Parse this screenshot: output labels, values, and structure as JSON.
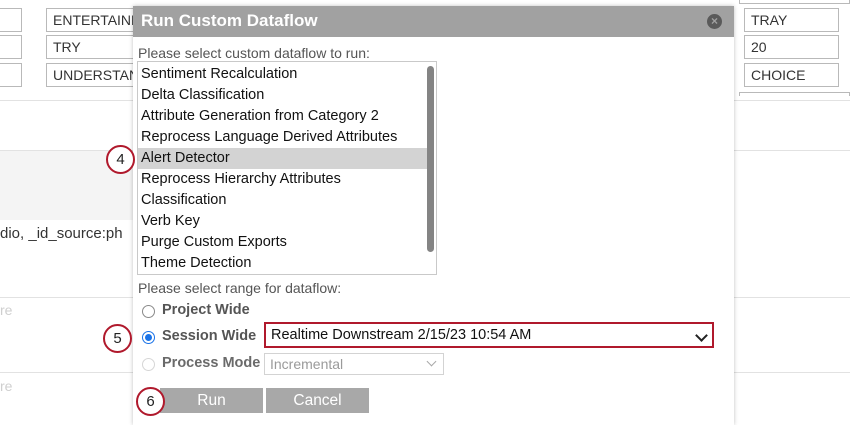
{
  "background": {
    "row1": {
      "col2": "ENTERTAINM",
      "col_right": "TRAY"
    },
    "row2": {
      "col2": "TRY",
      "col_right": "20"
    },
    "row3": {
      "col2": "UNDERSTAN",
      "col_right": "CHOICE"
    },
    "source_text": "dio, _id_source:ph",
    "faint1": "re",
    "faint2": "re"
  },
  "dialog": {
    "title": "Run Custom Dataflow",
    "close_glyph": "×",
    "select_label": "Please select custom dataflow to run:",
    "dataflows": [
      "Sentiment Recalculation",
      "Delta Classification",
      "Attribute Generation from Category 2",
      "Reprocess Language Derived Attributes",
      "Alert Detector",
      "Reprocess Hierarchy Attributes",
      "Classification",
      "Verb Key",
      "Purge Custom Exports",
      "Theme Detection"
    ],
    "selected_dataflow": "Alert Detector",
    "range_label": "Please select range for dataflow:",
    "range_options": {
      "project_wide": "Project Wide",
      "session_wide": "Session Wide",
      "process_mode": "Process Mode"
    },
    "selected_range": "Session Wide",
    "session_value": "Realtime Downstream 2/15/23 10:54 AM",
    "process_mode_value": "Incremental",
    "run_label": "Run",
    "cancel_label": "Cancel"
  },
  "markers": [
    "4",
    "5",
    "6"
  ],
  "colors": {
    "titlebar": "#a1a1a1",
    "highlight_red": "#b0192c",
    "radio_blue": "#1a73e8",
    "selected_row": "#d3d3d3",
    "button": "#a8a8a8"
  }
}
